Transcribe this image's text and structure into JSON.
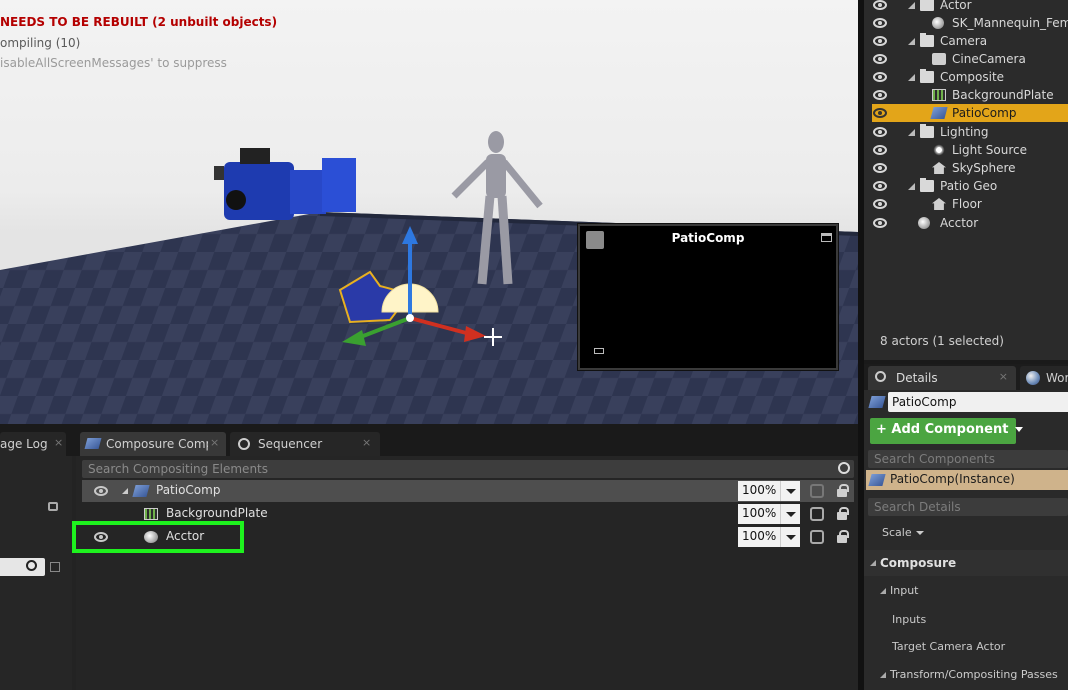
{
  "viewport": {
    "messages": [
      "NEEDS TO BE REBUILT (2 unbuilt objects)",
      "ompiling (10)",
      "isableAllScreenMessages' to suppress"
    ],
    "preview": {
      "title": "PatioComp"
    }
  },
  "outliner": {
    "items": [
      {
        "label": "Actor",
        "icon": "folder-icon"
      },
      {
        "label": "SK_Mannequin_Female",
        "icon": "skeletal-mesh-icon"
      },
      {
        "label": "Camera",
        "icon": "folder-icon"
      },
      {
        "label": "CineCamera",
        "icon": "cine-camera-icon"
      },
      {
        "label": "Composite",
        "icon": "folder-icon"
      },
      {
        "label": "BackgroundPlate",
        "icon": "film-icon"
      },
      {
        "label": "PatioComp",
        "icon": "composure-icon",
        "selected": true
      },
      {
        "label": "Lighting",
        "icon": "folder-icon"
      },
      {
        "label": "Light Source",
        "icon": "light-icon"
      },
      {
        "label": "SkySphere",
        "icon": "house-icon"
      },
      {
        "label": "Patio Geo",
        "icon": "folder-icon"
      },
      {
        "label": "Floor",
        "icon": "house-icon"
      },
      {
        "label": "Acctor",
        "icon": "sphere-icon"
      }
    ],
    "count_text": "8 actors (1 selected)"
  },
  "details": {
    "tab_label": "Details",
    "tab_close": "×",
    "world_tab_label": "Wor",
    "name_value": "PatioComp",
    "add_component_label": "+ Add Component",
    "search_components_placeholder": "Search Components",
    "instance_label": "PatioComp(Instance)",
    "search_details_placeholder": "Search Details",
    "scale_label": "Scale",
    "category_composure": "Composure",
    "category_input": "Input",
    "prop_inputs": "Inputs",
    "prop_target_camera": "Target Camera Actor",
    "category_transform": "Transform/Compositing Passes"
  },
  "bottom": {
    "tabs": [
      {
        "label": "age Log",
        "close": "×"
      },
      {
        "label": "Composure Compo",
        "close": "×"
      },
      {
        "label": "Sequencer",
        "close": "×"
      }
    ],
    "search_placeholder": "Search Compositing Elements",
    "rows": [
      {
        "label": "PatioComp",
        "percent": "100%"
      },
      {
        "label": "BackgroundPlate",
        "percent": "100%"
      },
      {
        "label": "Acctor",
        "percent": "100%"
      }
    ]
  },
  "colors": {
    "selection": "#e3a519",
    "add_component": "#4ba541",
    "highlight_box": "#1ef21e",
    "error_text": "#b40000"
  }
}
